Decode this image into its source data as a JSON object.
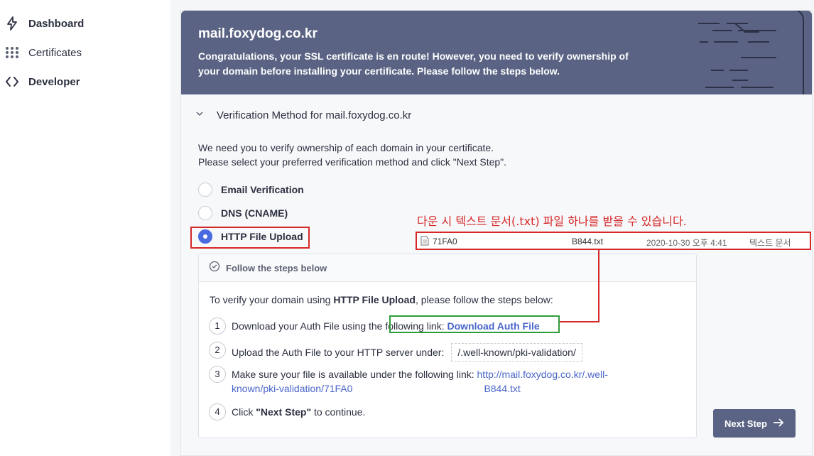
{
  "sidebar": {
    "items": [
      {
        "label": "Dashboard",
        "icon": "lightning-icon"
      },
      {
        "label": "Certificates",
        "icon": "grid-icon"
      },
      {
        "label": "Developer",
        "icon": "code-icon"
      }
    ]
  },
  "banner": {
    "domain": "mail.foxydog.co.kr",
    "message": "Congratulations, your SSL certificate is en route! However, you need to verify ownership of your domain before installing your certificate. Please follow the steps below."
  },
  "verification": {
    "title": "Verification Method for mail.foxydog.co.kr",
    "intro_line1": "We need you to verify ownership of each domain in your certificate.",
    "intro_line2": "Please select your preferred verification method and click \"Next Step\".",
    "methods": [
      {
        "label": "Email Verification",
        "checked": false
      },
      {
        "label": "DNS (CNAME)",
        "checked": false
      },
      {
        "label": "HTTP File Upload",
        "checked": true
      }
    ]
  },
  "steps": {
    "header": "Follow the steps below",
    "intro_prefix": "To verify your domain using ",
    "intro_bold": "HTTP File Upload",
    "intro_suffix": ", please follow the steps below:",
    "step1_text": "Download your Auth File using the following link: ",
    "step1_link": "Download Auth File",
    "step2_text": "Upload the Auth File to your HTTP server under:",
    "step2_path": "/.well-known/pki-validation/",
    "step3_text": "Make sure your file is available under the following link: ",
    "step3_link_a": "http://mail.foxydog.co.kr/.well-",
    "step3_link_b": "known/pki-validation/71FA0",
    "step3_link_c": "B844.txt",
    "step4_prefix": "Click ",
    "step4_bold": "\"Next Step\"",
    "step4_suffix": " to continue."
  },
  "next_button": "Next Step",
  "annotation": {
    "caption": "다운 시 텍스트 문서(.txt) 파일 하나를 받을 수 있습니다.",
    "file_name_a": "71FA0",
    "file_name_b": "B844.txt",
    "file_date": "2020-10-30 오후 4:41",
    "file_type": "텍스트 문서"
  },
  "colors": {
    "banner_bg": "#5a6383",
    "accent": "#4a6ae0",
    "link": "#4a66c9",
    "annotation_red": "#d62828",
    "annotation_green": "#2e9e3c"
  }
}
